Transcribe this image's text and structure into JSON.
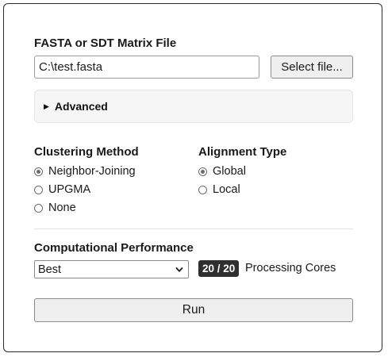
{
  "file": {
    "section_label": "FASTA or SDT Matrix File",
    "path_value": "C:\\test.fasta",
    "select_button_label": "Select file..."
  },
  "advanced": {
    "label": "Advanced",
    "expanded": false
  },
  "clustering": {
    "label": "Clustering Method",
    "options": [
      "Neighbor-Joining",
      "UPGMA",
      "None"
    ],
    "selected": "Neighbor-Joining"
  },
  "alignment": {
    "label": "Alignment Type",
    "options": [
      "Global",
      "Local"
    ],
    "selected": "Global"
  },
  "performance": {
    "label": "Computational Performance",
    "selected_option": "Best",
    "cores_badge": "20 / 20",
    "cores_label": "Processing Cores"
  },
  "run": {
    "label": "Run"
  }
}
